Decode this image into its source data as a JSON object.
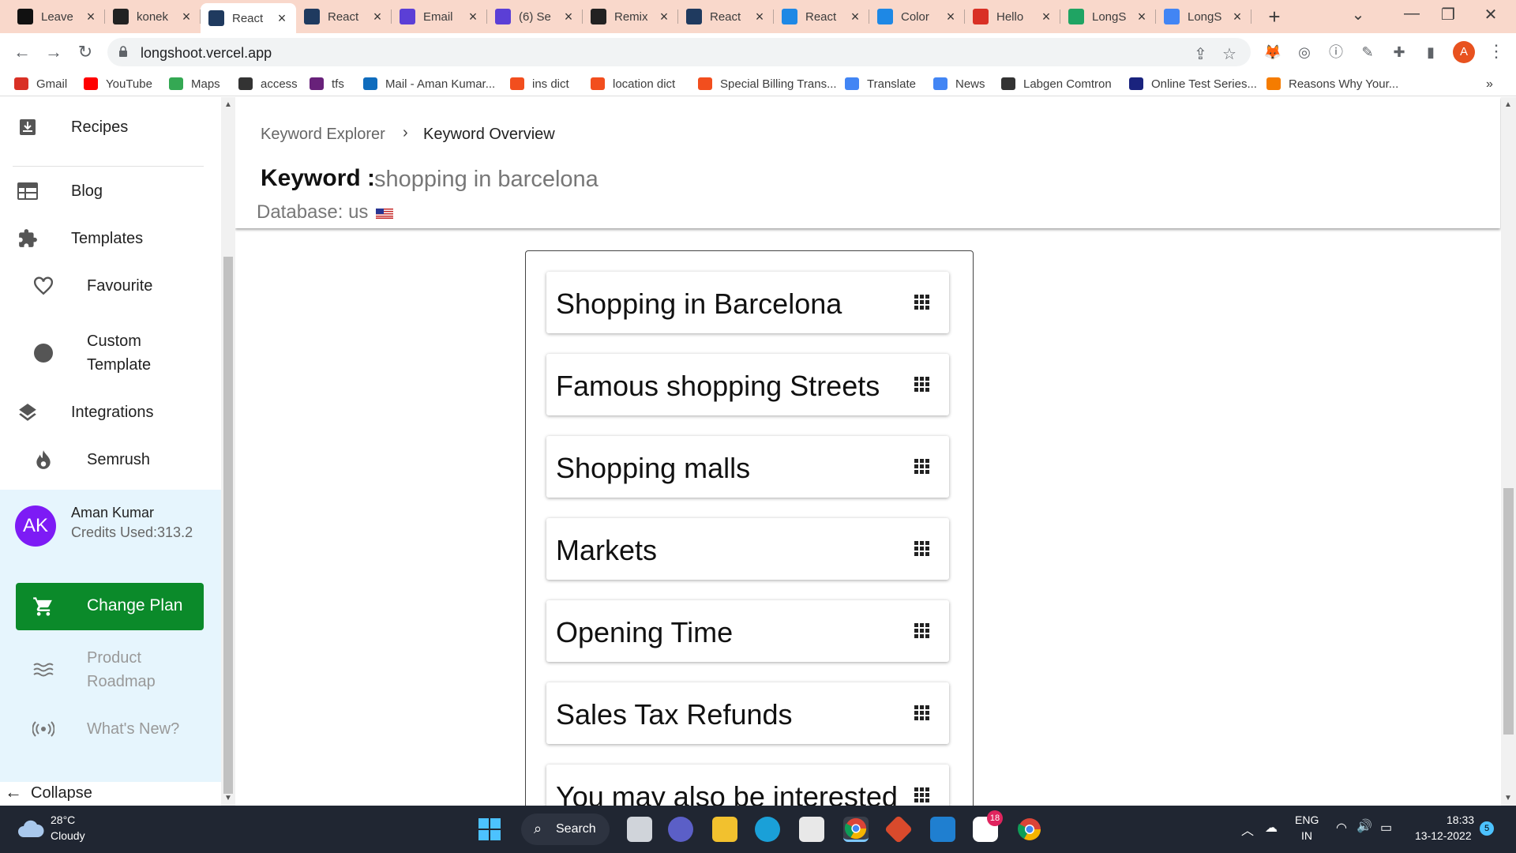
{
  "browser": {
    "tabs": [
      {
        "label": "Leave",
        "icon": "x-logo-icon",
        "color": "#111111"
      },
      {
        "label": "konek",
        "icon": "github-icon",
        "color": "#222222"
      },
      {
        "label": "React",
        "icon": "react-icon",
        "color": "#1f3a5f"
      },
      {
        "label": "React",
        "icon": "react-icon",
        "color": "#1f3a5f"
      },
      {
        "label": "Email",
        "icon": "hygraph-icon",
        "color": "#5b3fd6"
      },
      {
        "label": "(6) Se",
        "icon": "hygraph-icon",
        "color": "#5b3fd6"
      },
      {
        "label": "Remix",
        "icon": "remix-icon",
        "color": "#222222"
      },
      {
        "label": "React",
        "icon": "react-icon",
        "color": "#1f3a5f"
      },
      {
        "label": "React",
        "icon": "mui-icon",
        "color": "#1e88e5"
      },
      {
        "label": "Color",
        "icon": "mui-icon",
        "color": "#1e88e5"
      },
      {
        "label": "Hello",
        "icon": "gmail-icon",
        "color": "#d93025"
      },
      {
        "label": "LongS",
        "icon": "drive-icon",
        "color": "#1fa463"
      },
      {
        "label": "LongS",
        "icon": "docs-icon",
        "color": "#4285f4"
      }
    ],
    "active_tab_index": 2,
    "url": "longshoot.vercel.app",
    "profile_initial": "A",
    "bookmarks": [
      {
        "label": "Gmail",
        "icon": "gmail-icon",
        "color": "#d93025"
      },
      {
        "label": "YouTube",
        "icon": "youtube-icon",
        "color": "#ff0000"
      },
      {
        "label": "Maps",
        "icon": "maps-icon",
        "color": "#34a853"
      },
      {
        "label": "access",
        "icon": "globe-icon",
        "color": "#333333"
      },
      {
        "label": "tfs",
        "icon": "visual-studio-icon",
        "color": "#68217a"
      },
      {
        "label": "Mail - Aman Kumar...",
        "icon": "outlook-icon",
        "color": "#0f6cbd"
      },
      {
        "label": "ins dict",
        "icon": "figma-icon",
        "color": "#f24e1e"
      },
      {
        "label": "location dict",
        "icon": "figma-icon",
        "color": "#f24e1e"
      },
      {
        "label": "Special Billing Trans...",
        "icon": "figma-icon",
        "color": "#f24e1e"
      },
      {
        "label": "Translate",
        "icon": "translate-icon",
        "color": "#4285f4"
      },
      {
        "label": "News",
        "icon": "news-icon",
        "color": "#4285f4"
      },
      {
        "label": "Labgen Comtron",
        "icon": "globe-icon",
        "color": "#333333"
      },
      {
        "label": "Online Test Series...",
        "icon": "testbook-icon",
        "color": "#1a237e"
      },
      {
        "label": "Reasons Why Your...",
        "icon": "cx-icon",
        "color": "#f57c00"
      }
    ]
  },
  "sidebar": {
    "recipes": "Recipes",
    "blog": "Blog",
    "templates": "Templates",
    "favourite": "Favourite",
    "custom_template": "Custom Template",
    "integrations": "Integrations",
    "semrush": "Semrush",
    "user": {
      "initials": "AK",
      "name": "Aman Kumar",
      "credits": "Credits Used:313.2"
    },
    "change_plan": "Change Plan",
    "product_roadmap": "Product Roadmap",
    "whats_new": "What's New?",
    "collapse": "Collapse"
  },
  "main": {
    "breadcrumb": [
      "Keyword Explorer",
      "Keyword Overview"
    ],
    "keyword_label": "Keyword :",
    "keyword_value": "shopping in barcelona",
    "database_label": "Database: us",
    "cards": [
      "Shopping in Barcelona",
      "Famous shopping Streets",
      "Shopping malls",
      "Markets",
      "Opening Time",
      "Sales Tax Refunds",
      "You may also be interested"
    ]
  },
  "taskbar": {
    "temperature": "28°C",
    "weather": "Cloudy",
    "search": "Search",
    "language": "ENG",
    "region": "IN",
    "time": "18:33",
    "date": "13-12-2022",
    "notification_count": "5",
    "slack_badge": "18"
  },
  "colors": {
    "tabstrip": "#f9d8cb",
    "avatar": "#7d1bf5",
    "change_plan": "#0b8a2a",
    "user_card": "#e6f5fd",
    "taskbar": "#202632"
  }
}
